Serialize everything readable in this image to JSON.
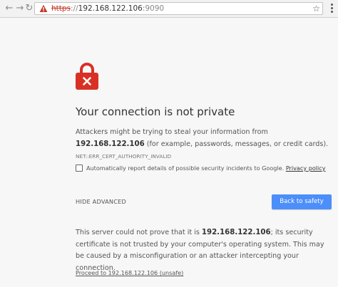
{
  "address_bar": {
    "scheme": "https",
    "separator": "://",
    "host": "192.168.122.106",
    "port": ":9090"
  },
  "icons": {
    "back": "back-arrow-icon",
    "forward": "forward-arrow-icon",
    "reload": "reload-icon",
    "security_warning": "not-secure-warning-icon",
    "bookmark": "star-icon",
    "menu": "kebab-menu-icon",
    "error": "red-broken-lock-icon"
  },
  "colors": {
    "danger": "#c53929",
    "lock": "#d93025",
    "primary_button": "#4c8efa"
  },
  "interstitial": {
    "heading": "Your connection is not private",
    "desc_prefix": "Attackers might be trying to steal your information from ",
    "desc_host": "192.168.122.106",
    "desc_suffix": " (for example, passwords, messages, or credit cards). ",
    "error_code": "NET::ERR_CERT_AUTHORITY_INVALID",
    "report_text": "Automatically report details of possible security incidents to Google. ",
    "privacy_link": "Privacy policy",
    "report_checked": false,
    "hide_advanced": "HIDE ADVANCED",
    "back_to_safety": "Back to safety",
    "detail_prefix": "This server could not prove that it is ",
    "detail_host": "192.168.122.106",
    "detail_suffix": "; its security certificate is not trusted by your computer's operating system. This may be caused by a misconfiguration or an attacker intercepting your connection.",
    "proceed_link": "Proceed to 192.168.122.106 (unsafe)"
  }
}
